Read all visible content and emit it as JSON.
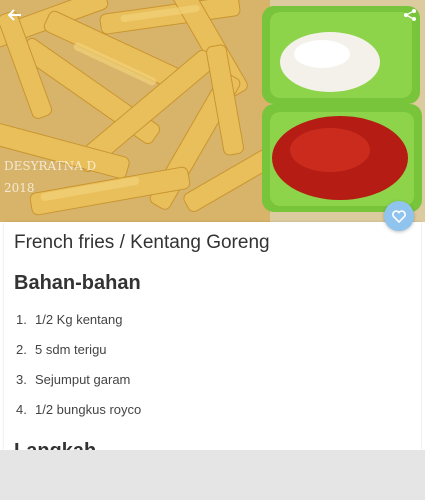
{
  "hero": {
    "image_label": "French fries photo with mayonnaise and ketchup",
    "watermark": "DESYRATNA D 2018",
    "back_icon": "arrow-left-icon",
    "share_icon": "share-icon"
  },
  "fab": {
    "icon": "heart-icon",
    "color": "#8fc4ee"
  },
  "recipe": {
    "title": "French fries / Kentang Goreng",
    "ingredients_heading": "Bahan-bahan",
    "ingredients": [
      {
        "num": "1.",
        "text": "1/2 Kg kentang"
      },
      {
        "num": "2.",
        "text": "5 sdm terigu"
      },
      {
        "num": "3.",
        "text": "Sejumput garam"
      },
      {
        "num": "4.",
        "text": "1/2 bungkus royco"
      }
    ],
    "steps_heading": "Langkah"
  }
}
